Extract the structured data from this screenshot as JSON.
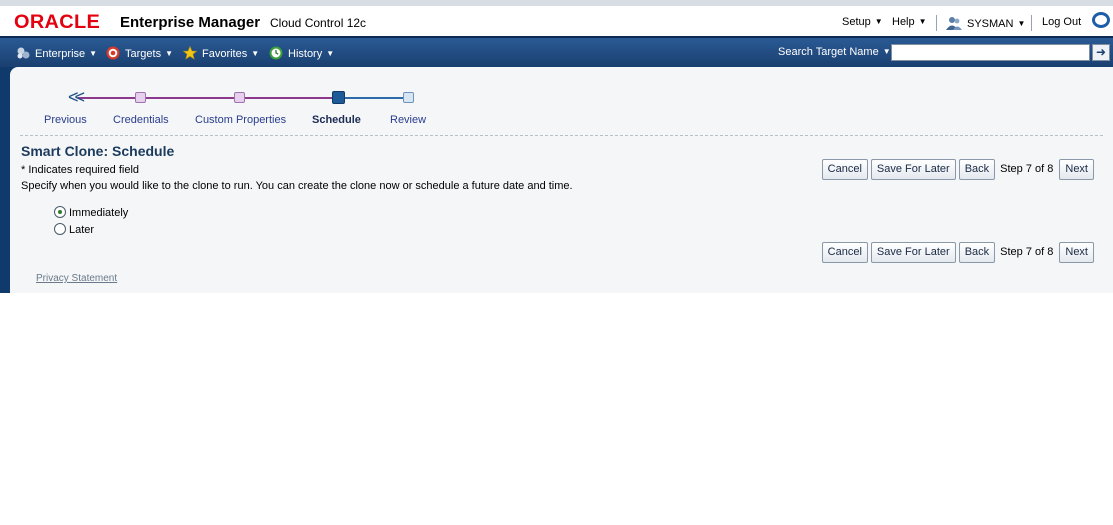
{
  "header": {
    "logo": "ORACLE",
    "product": "Enterprise Manager",
    "product_sub": "Cloud Control 12c",
    "setup": "Setup",
    "help": "Help",
    "user": "SYSMAN",
    "logout": "Log Out",
    "accent_red": "#e3000f",
    "icons": [
      "user-icon",
      "oracle-o-icon"
    ]
  },
  "navbar": {
    "enterprise": "Enterprise",
    "targets": "Targets",
    "favorites": "Favorites",
    "history": "History",
    "search_label": "Search Target Name",
    "search_value": "",
    "icons": [
      "enterprise-icon",
      "targets-icon",
      "favorites-star-icon",
      "history-clock-icon",
      "go-arrow-icon"
    ],
    "bar_color": "#1a3f70"
  },
  "train": {
    "previous": "Previous",
    "steps": [
      {
        "label": "Credentials",
        "state": "visited"
      },
      {
        "label": "Custom Properties",
        "state": "visited"
      },
      {
        "label": "Schedule",
        "state": "current"
      },
      {
        "label": "Review",
        "state": "next"
      }
    ]
  },
  "page": {
    "title": "Smart Clone: Schedule",
    "required_note": "* Indicates required field",
    "instructions": "Specify when you would like to the clone to run. You can create the clone now or schedule a future date and time.",
    "options": [
      {
        "label": "Immediately",
        "checked": true
      },
      {
        "label": "Later",
        "checked": false
      }
    ]
  },
  "buttons": {
    "cancel": "Cancel",
    "save_for_later": "Save For Later",
    "back": "Back",
    "step": "Step 7 of 8",
    "next": "Next"
  },
  "footer": {
    "privacy": "Privacy Statement"
  }
}
